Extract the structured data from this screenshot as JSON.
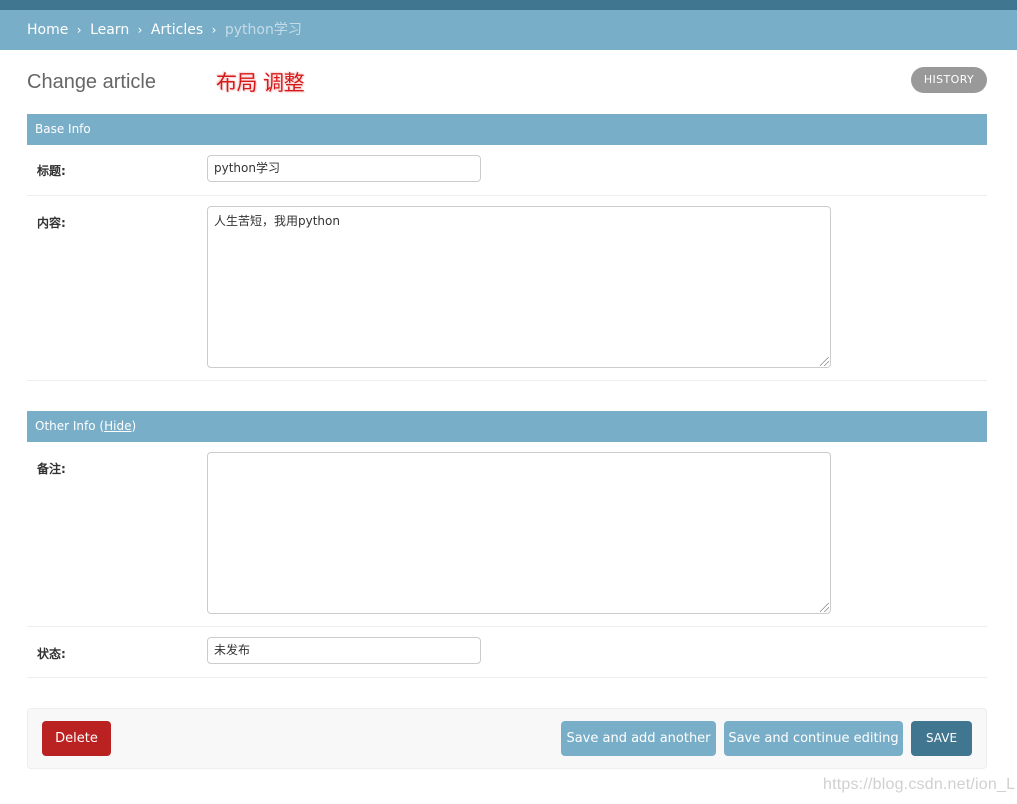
{
  "breadcrumbs": {
    "items": [
      "Home",
      "Learn",
      "Articles"
    ],
    "separator": "›",
    "current": "python学习"
  },
  "page": {
    "title": "Change article",
    "annotation": "布局 调整",
    "history_label": "HISTORY"
  },
  "fieldsets": {
    "base": {
      "title": "Base Info",
      "fields": {
        "title": {
          "label": "标题:",
          "value": "python学习"
        },
        "content": {
          "label": "内容:",
          "value": "人生苦短，我用python"
        }
      }
    },
    "other": {
      "title_prefix": "Other Info (",
      "hide_label": "Hide",
      "title_suffix": ")",
      "fields": {
        "remark": {
          "label": "备注:",
          "value": ""
        },
        "status": {
          "label": "状态:",
          "value": "未发布"
        }
      }
    }
  },
  "actions": {
    "delete_label": "Delete",
    "save_add_label": "Save and add another",
    "save_continue_label": "Save and continue editing",
    "save_label": "SAVE"
  },
  "watermark": "https://blog.csdn.net/ion_L",
  "colors": {
    "header_dark": "#417690",
    "header_light": "#79aec8",
    "delete_red": "#ba2121",
    "annotation_red": "#d61a1a"
  }
}
